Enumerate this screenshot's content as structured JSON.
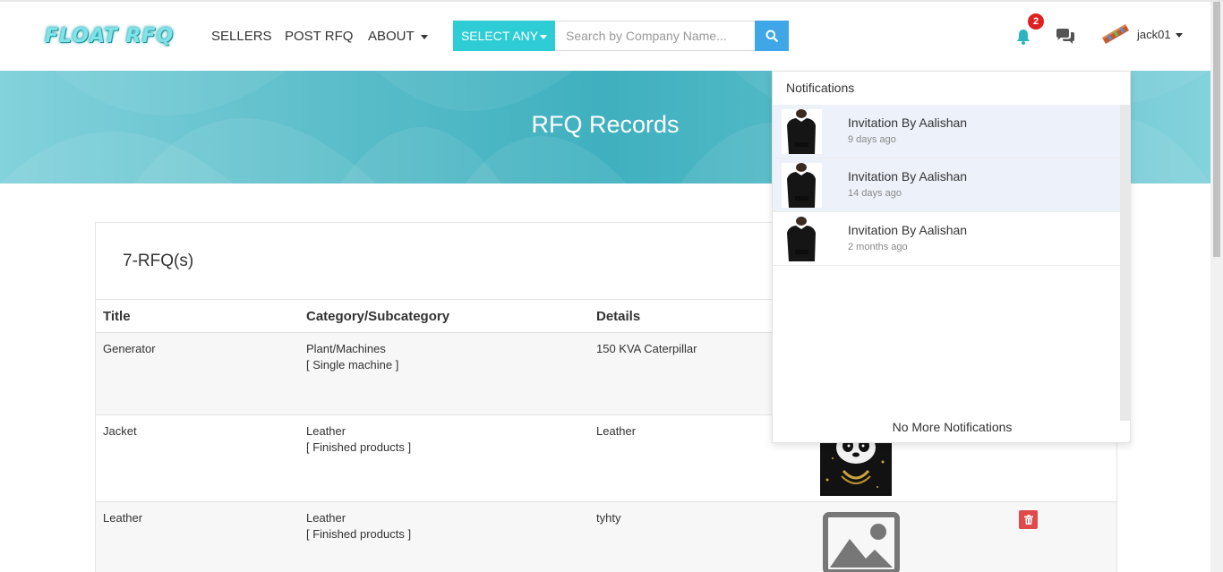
{
  "brand": {
    "logo_text": "FLOAT RFQ"
  },
  "nav": {
    "sellers": "SELLERS",
    "post_rfq": "POST RFQ",
    "about": "ABOUT"
  },
  "search": {
    "select_label": "SELECT ANY",
    "placeholder": "Search by Company Name..."
  },
  "user": {
    "notification_count": "2",
    "username": "jack01"
  },
  "banner": {
    "title": "RFQ Records"
  },
  "records": {
    "count_label": "7-RFQ(s)",
    "headers": {
      "title": "Title",
      "category": "Category/Subcategory",
      "details": "Details"
    },
    "rows": [
      {
        "title": "Generator",
        "category": "Plant/Machines",
        "subcategory": "[ Single machine ]",
        "details": "150 KVA Caterpillar"
      },
      {
        "title": "Jacket",
        "category": "Leather",
        "subcategory": "[ Finished products ]",
        "details": "Leather"
      },
      {
        "title": "Leather",
        "category": "Leather",
        "subcategory": "[ Finished products ]",
        "details": "tyhty"
      }
    ]
  },
  "notifications": {
    "header": "Notifications",
    "items": [
      {
        "title": "Invitation By Aalishan",
        "time": "9 days ago",
        "unread": true
      },
      {
        "title": "Invitation By Aalishan",
        "time": "14 days ago",
        "unread": true
      },
      {
        "title": "Invitation By Aalishan",
        "time": "2 months ago",
        "unread": false
      }
    ],
    "footer": "No More Notifications"
  },
  "colors": {
    "accent_cyan": "#2ecdd5",
    "search_blue": "#3fa6e8",
    "badge_red": "#e02020",
    "delete_red": "#e14a4a",
    "bell_cyan": "#2cb5c0"
  }
}
